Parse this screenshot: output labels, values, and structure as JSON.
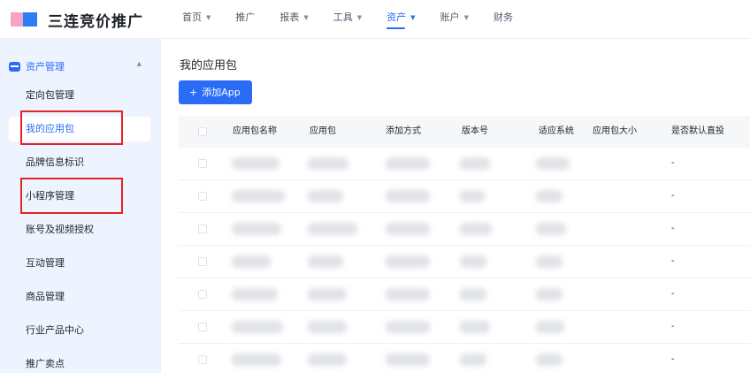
{
  "brand": {
    "title": "三连竞价推广",
    "colors": {
      "accent": "#2b6cf6",
      "logo_pink": "#f5a3c7",
      "logo_blue": "#2b7df5",
      "annotation_red": "#e32424"
    }
  },
  "nav": {
    "items": [
      {
        "label": "首页",
        "dropdown": true,
        "active": false
      },
      {
        "label": "推广",
        "dropdown": false,
        "active": false
      },
      {
        "label": "报表",
        "dropdown": true,
        "active": false
      },
      {
        "label": "工具",
        "dropdown": true,
        "active": false
      },
      {
        "label": "资产",
        "dropdown": true,
        "active": true
      },
      {
        "label": "账户",
        "dropdown": true,
        "active": false
      },
      {
        "label": "财务",
        "dropdown": false,
        "active": false
      }
    ],
    "caret": "▼"
  },
  "sidebar": {
    "group_label": "资产管理",
    "group_chevron": "▲",
    "items": [
      {
        "label": "定向包管理",
        "active": false
      },
      {
        "label": "我的应用包",
        "active": true
      },
      {
        "label": "品牌信息标识",
        "active": false
      },
      {
        "label": "小程序管理",
        "active": false
      },
      {
        "label": "账号及视频授权",
        "active": false
      },
      {
        "label": "互动管理",
        "active": false
      },
      {
        "label": "商品管理",
        "active": false
      },
      {
        "label": "行业产品中心",
        "active": false
      },
      {
        "label": "推广卖点",
        "active": false
      }
    ]
  },
  "main": {
    "title": "我的应用包",
    "add_button": {
      "plus": "+",
      "label": "添加App"
    },
    "table": {
      "columns": [
        "应用包名称",
        "应用包",
        "添加方式",
        "版本号",
        "适应系统",
        "应用包大小",
        "是否默认直投"
      ],
      "rows": [
        {
          "default_direct": "-"
        },
        {
          "default_direct": "-"
        },
        {
          "default_direct": "-"
        },
        {
          "default_direct": "-"
        },
        {
          "default_direct": "-"
        },
        {
          "default_direct": "-"
        },
        {
          "default_direct": "-"
        }
      ]
    }
  }
}
